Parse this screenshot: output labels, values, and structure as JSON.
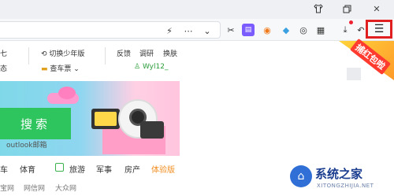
{
  "titlebar": {
    "icons": [
      "shirt-icon",
      "restore-icon",
      "close-icon"
    ]
  },
  "toolbar": {
    "icons": [
      "bolt-icon",
      "more-icon",
      "chevron-down-icon",
      "scissors-icon",
      "notepad-icon",
      "game-icon",
      "bird-icon",
      "eye-icon",
      "apps-icon",
      "download-icon",
      "back-icon",
      "menu-icon"
    ]
  },
  "topnav": {
    "left_fragment_1": "七",
    "left_fragment_2": "态",
    "switch_youth": "切换少年版",
    "train_tickets": "查车票",
    "feedback": "反馈",
    "survey": "调研",
    "skin": "换肤",
    "username": "Wyl12_"
  },
  "banner": {
    "search_button": "搜索",
    "mail_link": "outlook邮箱"
  },
  "categories": [
    {
      "label": "车"
    },
    {
      "label": "体育"
    },
    {
      "label": "旅游"
    },
    {
      "label": "军事"
    },
    {
      "label": "房产"
    },
    {
      "label": "体验版"
    }
  ],
  "bottom_links": [
    {
      "label": "宝网"
    },
    {
      "label": "网信网"
    },
    {
      "label": "大众网"
    }
  ],
  "promo": {
    "text": "捕红包啦"
  },
  "watermark": {
    "title": "系统之家",
    "subtitle": "XITONGZHIJIA.NET"
  },
  "colors": {
    "search_green": "#2ec55e",
    "highlight_orange": "#f08c1e",
    "menu_outline_red": "#e02020"
  }
}
